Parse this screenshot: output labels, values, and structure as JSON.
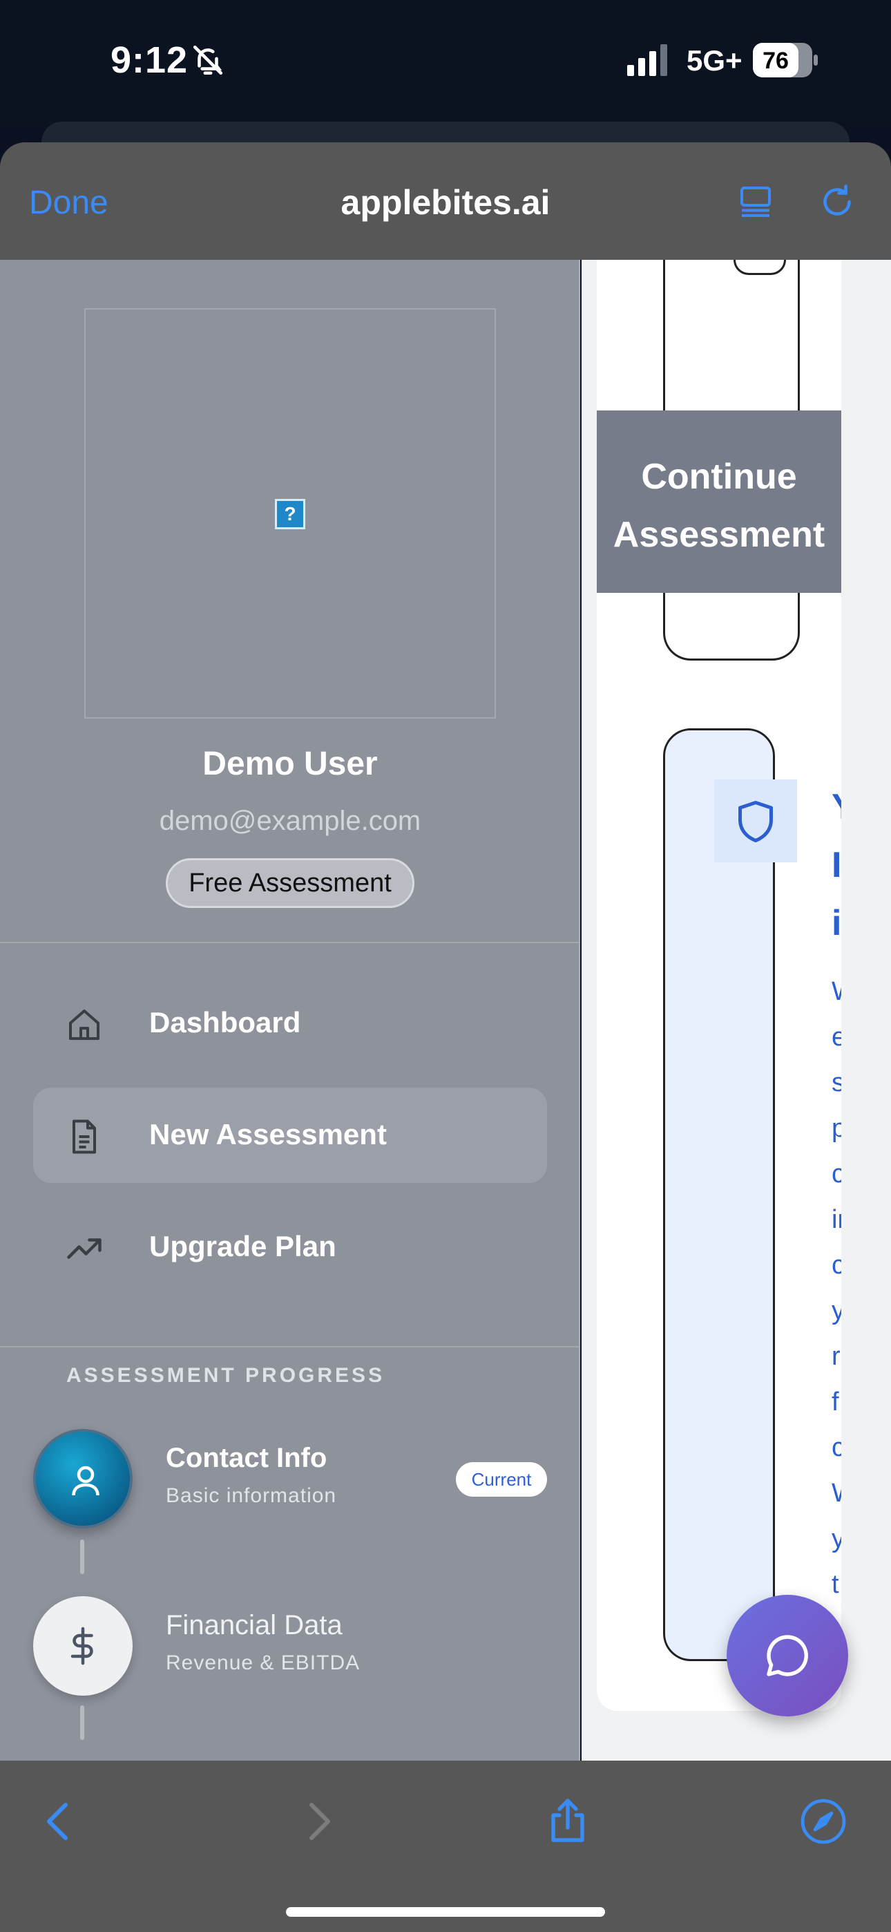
{
  "status_bar": {
    "time": "9:12",
    "network": "5G+",
    "battery": "76",
    "icons": [
      "bell-slash-icon",
      "signal-icon",
      "battery-icon"
    ]
  },
  "browser": {
    "done_label": "Done",
    "site_title": "applebites.ai",
    "icons": [
      "reader-icon",
      "reload-icon",
      "back-icon",
      "forward-icon",
      "share-icon",
      "compass-icon"
    ],
    "accent": "#3b8bf5"
  },
  "sidebar": {
    "user": {
      "name": "Demo User",
      "email": "demo@example.com",
      "plan": "Free Assessment",
      "broken_image_glyph": "?"
    },
    "nav": [
      {
        "label": "Dashboard",
        "icon": "home-icon",
        "active": false
      },
      {
        "label": "New Assessment",
        "icon": "document-icon",
        "active": true
      },
      {
        "label": "Upgrade Plan",
        "icon": "trending-up-icon",
        "active": false
      }
    ],
    "progress": {
      "title": "ASSESSMENT PROGRESS",
      "steps": [
        {
          "title": "Contact Info",
          "subtitle": "Basic information",
          "icon": "user-icon",
          "badge": "Current"
        },
        {
          "title": "Financial Data",
          "subtitle": "Revenue & EBITDA",
          "icon": "dollar-icon"
        }
      ]
    }
  },
  "main": {
    "continue_button": "Continue Assessment",
    "shield_icon": "shield-icon",
    "clipped_heading": [
      "Y",
      "I",
      "i"
    ],
    "clipped_body": [
      "W",
      "e",
      "s",
      "p",
      "c",
      "in",
      "c",
      "y",
      "r",
      "f",
      "c",
      "W",
      "y",
      "t"
    ],
    "chat_icon": "chat-bubble-icon",
    "chat_gradient": [
      "#6b6fe0",
      "#7a4fbf"
    ]
  }
}
